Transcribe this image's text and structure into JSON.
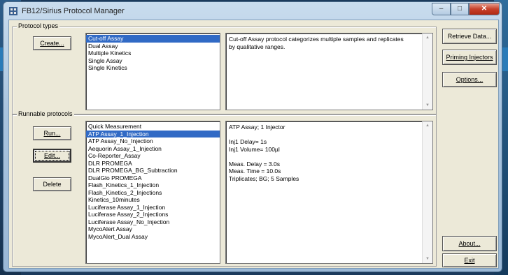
{
  "window": {
    "title": "FB12/Sirius Protocol Manager",
    "minimize_glyph": "–",
    "maximize_glyph": "□",
    "close_glyph": "✕"
  },
  "protocol_types": {
    "group_label": "Protocol types",
    "create_button": "Create...",
    "items": [
      {
        "label": "Cut-off Assay",
        "selected": true
      },
      {
        "label": "Dual Assay",
        "selected": false
      },
      {
        "label": "Multiple Kinetics",
        "selected": false
      },
      {
        "label": "Single Assay",
        "selected": false
      },
      {
        "label": "Single Kinetics",
        "selected": false
      }
    ],
    "description": "Cut-off Assay protocol categorizes multiple samples and replicates by qualitative ranges."
  },
  "runnable_protocols": {
    "group_label": "Runnable protocols",
    "run_button": "Run...",
    "edit_button": "Edit...",
    "delete_button": "Delete",
    "items": [
      {
        "label": "Quick Measurement",
        "selected": false
      },
      {
        "label": "ATP Assay_1_Injection",
        "selected": true
      },
      {
        "label": "ATP Assay_No_Injection",
        "selected": false
      },
      {
        "label": "Aequorin Assay_1_Injection",
        "selected": false
      },
      {
        "label": "Co-Reporter_Assay",
        "selected": false
      },
      {
        "label": "DLR PROMEGA",
        "selected": false
      },
      {
        "label": "DLR PROMEGA_BG_Subtraction",
        "selected": false
      },
      {
        "label": "DualGlo PROMEGA",
        "selected": false
      },
      {
        "label": "Flash_Kinetics_1_Injection",
        "selected": false
      },
      {
        "label": "Flash_Kinetics_2_Injections",
        "selected": false
      },
      {
        "label": "Kinetics_10minutes",
        "selected": false
      },
      {
        "label": "Luciferase Assay_1_Injection",
        "selected": false
      },
      {
        "label": "Luciferase Assay_2_Injections",
        "selected": false
      },
      {
        "label": "Luciferase Assay_No_Injection",
        "selected": false
      },
      {
        "label": "MycoAlert Assay",
        "selected": false
      },
      {
        "label": "MycoAlert_Dual Assay",
        "selected": false
      }
    ],
    "details": "ATP Assay; 1 Injector\n\nInj1 Delay= 1s\nInj1 Volume= 100µl\n\nMeas. Delay = 3.0s\nMeas. Time = 10.0s\nTriplicates; BG; 5 Samples"
  },
  "side_buttons": {
    "retrieve_data": "Retrieve Data...",
    "priming_injectors": "Priming Injectors",
    "options": "Options...",
    "about": "About...",
    "exit": "Exit"
  }
}
